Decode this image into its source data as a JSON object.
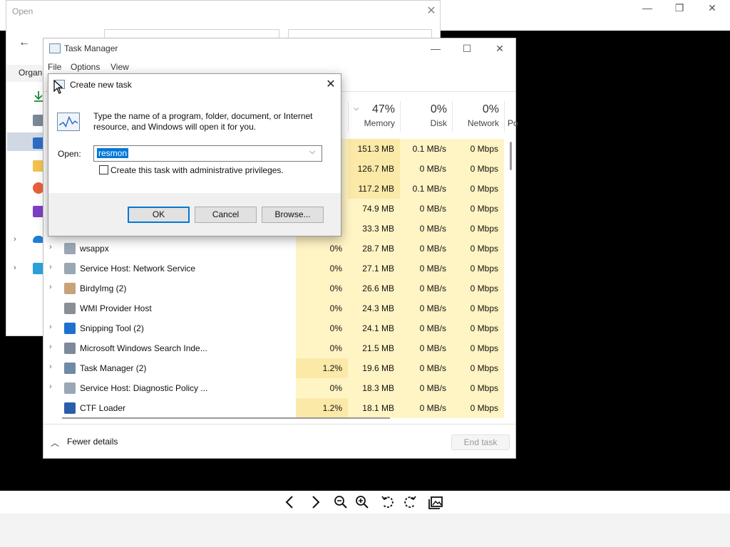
{
  "viewer": {
    "caption_minimize": "—",
    "caption_maximize": "❐",
    "caption_close": "✕",
    "toolbar": [
      "previous-icon",
      "next-icon",
      "zoom-out-icon",
      "zoom-in-icon",
      "rotate-left-icon",
      "rotate-right-icon",
      "gallery-icon"
    ]
  },
  "open_dialog": {
    "title": "Open",
    "close": "✕",
    "back": "←",
    "organize": "Organ"
  },
  "task_manager": {
    "title": "Task Manager",
    "caption_minimize": "—",
    "caption_maximize": "☐",
    "caption_close": "✕",
    "menu": [
      "File",
      "Options",
      "View"
    ],
    "columns": {
      "memory": {
        "pct": "47%",
        "label": "Memory"
      },
      "disk": {
        "pct": "0%",
        "label": "Disk"
      },
      "network": {
        "pct": "0%",
        "label": "Network"
      },
      "power_partial": "Po"
    },
    "rows": [
      {
        "name": "",
        "cpu": "",
        "memory": "151.3 MB",
        "disk": "0.1 MB/s",
        "network": "0 Mbps",
        "expand": false
      },
      {
        "name": "",
        "cpu": "",
        "memory": "126.7 MB",
        "disk": "0 MB/s",
        "network": "0 Mbps",
        "expand": false
      },
      {
        "name": "",
        "cpu": "",
        "memory": "117.2 MB",
        "disk": "0.1 MB/s",
        "network": "0 Mbps",
        "expand": false
      },
      {
        "name": "",
        "cpu": "",
        "memory": "74.9 MB",
        "disk": "0 MB/s",
        "network": "0 Mbps",
        "expand": false
      },
      {
        "name": "",
        "cpu": "",
        "memory": "33.3 MB",
        "disk": "0 MB/s",
        "network": "0 Mbps",
        "expand": false
      },
      {
        "name": "wsappx",
        "cpu": "0%",
        "memory": "28.7 MB",
        "disk": "0 MB/s",
        "network": "0 Mbps",
        "expand": true
      },
      {
        "name": "Service Host: Network Service",
        "cpu": "0%",
        "memory": "27.1 MB",
        "disk": "0 MB/s",
        "network": "0 Mbps",
        "expand": true
      },
      {
        "name": "BirdyImg (2)",
        "cpu": "0%",
        "memory": "26.6 MB",
        "disk": "0 MB/s",
        "network": "0 Mbps",
        "expand": true
      },
      {
        "name": "WMI Provider Host",
        "cpu": "0%",
        "memory": "24.3 MB",
        "disk": "0 MB/s",
        "network": "0 Mbps",
        "expand": false
      },
      {
        "name": "Snipping Tool (2)",
        "cpu": "0%",
        "memory": "24.1 MB",
        "disk": "0 MB/s",
        "network": "0 Mbps",
        "expand": true
      },
      {
        "name": "Microsoft Windows Search Inde...",
        "cpu": "0%",
        "memory": "21.5 MB",
        "disk": "0 MB/s",
        "network": "0 Mbps",
        "expand": true
      },
      {
        "name": "Task Manager (2)",
        "cpu": "1.2%",
        "memory": "19.6 MB",
        "disk": "0 MB/s",
        "network": "0 Mbps",
        "expand": true
      },
      {
        "name": "Service Host: Diagnostic Policy ...",
        "cpu": "0%",
        "memory": "18.3 MB",
        "disk": "0 MB/s",
        "network": "0 Mbps",
        "expand": true
      },
      {
        "name": "CTF Loader",
        "cpu": "1.2%",
        "memory": "18.1 MB",
        "disk": "0 MB/s",
        "network": "0 Mbps",
        "expand": false
      }
    ],
    "fewer_details": "Fewer details",
    "end_task": "End task"
  },
  "create_task": {
    "title": "Create new task",
    "close": "✕",
    "description": "Type the name of a program, folder, document, or Internet resource, and Windows will open it for you.",
    "open_label": "Open:",
    "open_value": "resmon",
    "admin_checkbox_label": "Create this task with administrative privileges.",
    "admin_checked": false,
    "ok": "OK",
    "cancel": "Cancel",
    "browse": "Browse..."
  },
  "colors": {
    "accent": "#0078d7",
    "cell_light": "#fff4c4",
    "cell_hot": "#fbe9a8"
  }
}
